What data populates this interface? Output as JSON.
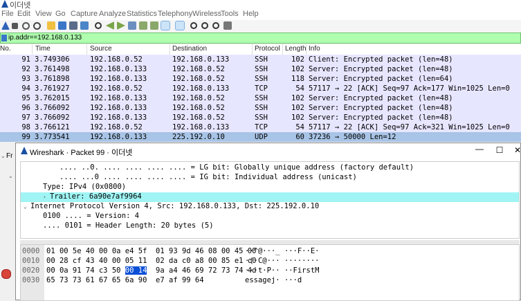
{
  "main_window": {
    "title": "이더넷",
    "menu": [
      "File",
      "Edit",
      "View",
      "Go",
      "Capture",
      "Analyze",
      "Statistics",
      "Telephony",
      "Wireless",
      "Tools",
      "Help"
    ],
    "filter": "ip.addr==192.168.0.133",
    "columns": [
      "No.",
      "Time",
      "Source",
      "Destination",
      "Protocol",
      "Length",
      "Info"
    ],
    "packets": [
      {
        "no": "91",
        "time": "3.749306",
        "src": "192.168.0.52",
        "dst": "192.168.0.133",
        "proto": "SSH",
        "len": "102",
        "info": "Client: Encrypted packet (len=48)",
        "kind": "ssh"
      },
      {
        "no": "92",
        "time": "3.761498",
        "src": "192.168.0.133",
        "dst": "192.168.0.52",
        "proto": "SSH",
        "len": "102",
        "info": "Server: Encrypted packet (len=48)",
        "kind": "ssh"
      },
      {
        "no": "93",
        "time": "3.761898",
        "src": "192.168.0.133",
        "dst": "192.168.0.52",
        "proto": "SSH",
        "len": "118",
        "info": "Server: Encrypted packet (len=64)",
        "kind": "ssh"
      },
      {
        "no": "94",
        "time": "3.761927",
        "src": "192.168.0.52",
        "dst": "192.168.0.133",
        "proto": "TCP",
        "len": "54",
        "info": "57117 → 22 [ACK] Seq=97 Ack=177 Win=1025 Len=0",
        "kind": "tcp"
      },
      {
        "no": "95",
        "time": "3.762015",
        "src": "192.168.0.133",
        "dst": "192.168.0.52",
        "proto": "SSH",
        "len": "102",
        "info": "Server: Encrypted packet (len=48)",
        "kind": "ssh"
      },
      {
        "no": "96",
        "time": "3.766092",
        "src": "192.168.0.133",
        "dst": "192.168.0.52",
        "proto": "SSH",
        "len": "102",
        "info": "Server: Encrypted packet (len=48)",
        "kind": "ssh"
      },
      {
        "no": "97",
        "time": "3.766092",
        "src": "192.168.0.133",
        "dst": "192.168.0.52",
        "proto": "SSH",
        "len": "102",
        "info": "Server: Encrypted packet (len=48)",
        "kind": "ssh"
      },
      {
        "no": "98",
        "time": "3.766121",
        "src": "192.168.0.52",
        "dst": "192.168.0.133",
        "proto": "TCP",
        "len": "54",
        "info": "57117 → 22 [ACK] Seq=97 Ack=321 Win=1025 Len=0",
        "kind": "tcp"
      },
      {
        "no": "99",
        "time": "3.773541",
        "src": "192.168.0.133",
        "dst": "225.192.0.10",
        "proto": "UDP",
        "len": "60",
        "info": "37236 → 50000 Len=12",
        "kind": "udp"
      }
    ],
    "left_labels": [
      "Fr"
    ]
  },
  "dialog": {
    "title": "Wireshark · Packet 99 · 이더넷",
    "tree": [
      {
        "text": ".... ..0. .... .... .... .... = LG bit: Globally unique address (factory default)",
        "indent": 3,
        "arrow": "",
        "hl": false
      },
      {
        "text": ".... ...0 .... .... .... .... = IG bit: Individual address (unicast)",
        "indent": 3,
        "arrow": "",
        "hl": false
      },
      {
        "text": "Type: IPv4 (0x0800)",
        "indent": 2,
        "arrow": "",
        "hl": false
      },
      {
        "text": "Trailer: 6a90e7af9964",
        "indent": 2,
        "arrow": "›",
        "hl": true
      },
      {
        "text": "Internet Protocol Version 4, Src: 192.168.0.133, Dst: 225.192.0.10",
        "indent": 0,
        "arrow": "⌄",
        "hl": false
      },
      {
        "text": "0100 .... = Version: 4",
        "indent": 2,
        "arrow": "",
        "hl": false
      },
      {
        "text": ".... 0101 = Header Length: 20 bytes (5)",
        "indent": 2,
        "arrow": "",
        "hl": false
      }
    ],
    "hex": [
      {
        "off": "0000",
        "pre": "01 00 5e 40 00 0a e4 5f  01 93 9d 46 08 00 45 00",
        "sel": "",
        "post": "",
        "ascii": "··^@···_ ···F··E·"
      },
      {
        "off": "0010",
        "pre": "00 28 cf 43 40 00 05 11  02 da c0 a8 00 85 e1 c0",
        "sel": "",
        "post": "",
        "ascii": "·(·C@··· ········"
      },
      {
        "off": "0020",
        "pre": "00 0a 91 74 c3 50 ",
        "sel": "00 14",
        "post": "  9a a4 46 69 72 73 74 4d",
        "ascii": "···t·P·· ··FirstM"
      },
      {
        "off": "0030",
        "pre": "65 73 73 61 67 65 6a 90  e7 af 99 64",
        "sel": "",
        "post": "",
        "ascii": "essagej· ···d"
      }
    ]
  }
}
